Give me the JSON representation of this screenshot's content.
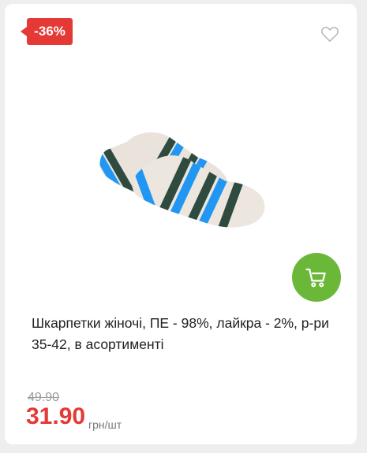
{
  "badge": {
    "discount": "-36%"
  },
  "product": {
    "image": "striped-socks-image",
    "title": "Шкарпетки жіночі, ПЕ - 98%, лайкра - 2%, р-ри 35-42, в асортименті",
    "old_price": "49.90",
    "price": "31.90",
    "unit": "грн/шт"
  },
  "icons": {
    "favorite": "heart-icon",
    "cart": "cart-icon"
  },
  "colors": {
    "sale": "#e53935",
    "cart_button": "#6bb839"
  }
}
